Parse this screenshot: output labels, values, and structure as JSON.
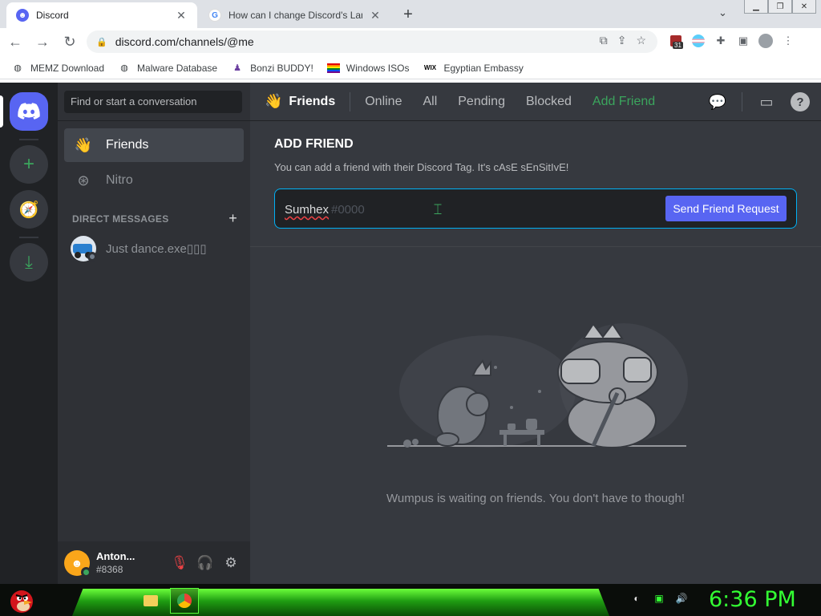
{
  "browser": {
    "tabs": [
      {
        "title": "Discord",
        "active": true
      },
      {
        "title": "How can I change Discord's Lang",
        "active": false
      }
    ],
    "url": "discord.com/channels/@me",
    "extension_badge": "31",
    "bookmarks": [
      {
        "label": "MEMZ Download",
        "icon": "globe-icon"
      },
      {
        "label": "Malware Database",
        "icon": "globe-icon"
      },
      {
        "label": "Bonzi BUDDY!",
        "icon": "bonzi-icon"
      },
      {
        "label": "Windows ISOs",
        "icon": "rainbow-flag-icon"
      },
      {
        "label": "Egyptian Embassy",
        "icon": "wix-icon"
      }
    ],
    "wix_label": "WIX"
  },
  "discord": {
    "accent": "#5865f2",
    "green": "#3ba55d",
    "search_placeholder": "Find or start a conversation",
    "nav": {
      "friends": "Friends",
      "nitro": "Nitro"
    },
    "dm_header": "DIRECT MESSAGES",
    "dm_plus": "+",
    "dms": [
      {
        "name": "Just dance.exe▯▯▯"
      }
    ],
    "user": {
      "name": "Anton...",
      "tag": "#8368"
    },
    "topbar": {
      "title": "Friends",
      "tabs": [
        "Online",
        "All",
        "Pending",
        "Blocked"
      ],
      "add_friend": "Add Friend"
    },
    "add_friend": {
      "title": "ADD FRIEND",
      "subtitle": "You can add a friend with their Discord Tag. It's cAsE sEnSitIvE!",
      "input_value": "Sumhex",
      "input_placeholder": "#0000",
      "button": "Send Friend Request"
    },
    "empty_state": "Wumpus is waiting on friends. You don't have to though!"
  },
  "taskbar": {
    "clock": "6:36 PM"
  }
}
